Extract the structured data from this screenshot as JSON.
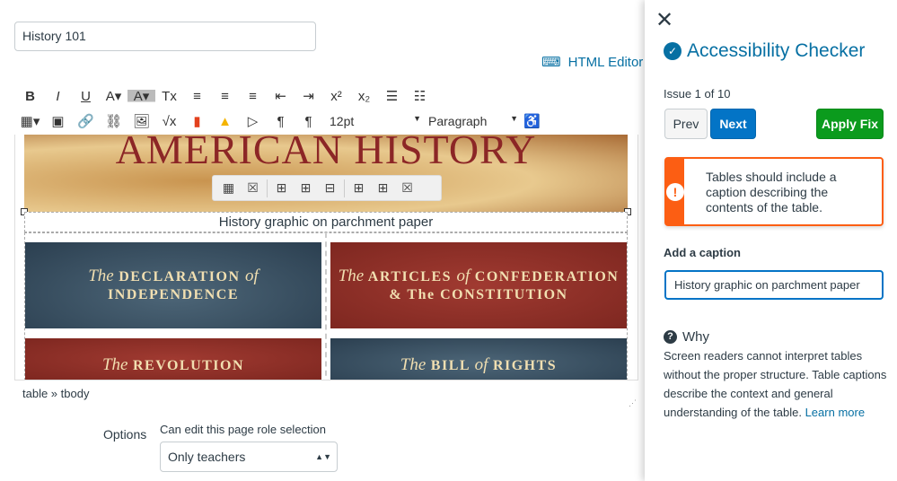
{
  "page": {
    "title_value": "History 101",
    "html_editor_label": "HTML Editor"
  },
  "toolbar": {
    "font_size": "12pt",
    "block_format": "Paragraph",
    "row1": [
      {
        "icon": "bold-icon",
        "glyph": "B"
      },
      {
        "icon": "italic-icon",
        "glyph": "I"
      },
      {
        "icon": "underline-icon",
        "glyph": "U"
      },
      {
        "icon": "text-color-icon",
        "glyph": "A▾"
      },
      {
        "icon": "background-color-icon",
        "glyph": "A▾"
      },
      {
        "icon": "clear-formatting-icon",
        "glyph": "Tx"
      },
      {
        "icon": "align-left-icon",
        "glyph": "≡"
      },
      {
        "icon": "align-center-icon",
        "glyph": "≡"
      },
      {
        "icon": "align-right-icon",
        "glyph": "≡"
      },
      {
        "icon": "outdent-icon",
        "glyph": "⇤"
      },
      {
        "icon": "indent-icon",
        "glyph": "⇥"
      },
      {
        "icon": "superscript-icon",
        "glyph": "x²"
      },
      {
        "icon": "subscript-icon",
        "glyph": "x₂"
      },
      {
        "icon": "bullet-list-icon",
        "glyph": "☰"
      },
      {
        "icon": "numbered-list-icon",
        "glyph": "☷"
      }
    ],
    "row2": [
      {
        "icon": "table-icon",
        "glyph": "▦▾"
      },
      {
        "icon": "media-icon",
        "glyph": "▣"
      },
      {
        "icon": "link-icon",
        "glyph": "🔗"
      },
      {
        "icon": "unlink-icon",
        "glyph": "⛓"
      },
      {
        "icon": "image-icon",
        "glyph": "🖼"
      },
      {
        "icon": "math-icon",
        "glyph": "√x"
      },
      {
        "icon": "office-icon",
        "glyph": "▮"
      },
      {
        "icon": "google-drive-icon",
        "glyph": "▲"
      },
      {
        "icon": "video-icon",
        "glyph": "▷"
      },
      {
        "icon": "ltr-icon",
        "glyph": "¶"
      },
      {
        "icon": "rtl-icon",
        "glyph": "¶"
      }
    ]
  },
  "content": {
    "banner": "AMERICAN HISTORY",
    "caption": "History graphic on parchment paper",
    "cells": [
      {
        "pre": "The",
        "main": "DECLARATION",
        "mid": "of",
        "end": "INDEPENDENCE",
        "color": "blue"
      },
      {
        "pre": "The",
        "main": "ARTICLES",
        "mid": "of",
        "end": "CONFEDERATION",
        "line2": "& The CONSTITUTION",
        "color": "red"
      },
      {
        "pre": "The",
        "main": "REVOLUTION",
        "color": "red"
      },
      {
        "pre": "The",
        "main": "BILL",
        "mid": "of",
        "end": "RIGHTS",
        "color": "blue"
      }
    ]
  },
  "status_path": "table » tbody",
  "options": {
    "label": "Options",
    "role_label": "Can edit this page role selection",
    "role_value": "Only teachers"
  },
  "panel": {
    "title": "Accessibility Checker",
    "issue": "Issue 1 of 10",
    "prev": "Prev",
    "next": "Next",
    "apply": "Apply Fix",
    "alert": "Tables should include a caption describing the contents of the table.",
    "caption_label": "Add a caption",
    "caption_value": "History graphic on parchment paper",
    "why_title": "Why",
    "why_text": "Screen readers cannot interpret tables without the proper structure. Table captions describe the context and general understanding of the table.",
    "learn_more": "Learn more"
  },
  "colors": {
    "primary": "#0374c6",
    "success": "#0b9b1d",
    "warning": "#fc5e13",
    "link": "#0770a3"
  }
}
